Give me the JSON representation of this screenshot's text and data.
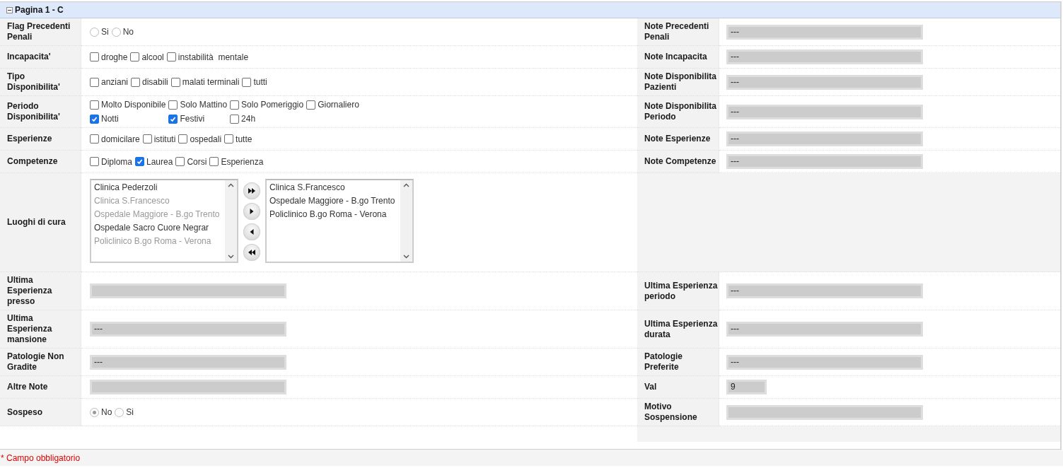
{
  "panel": {
    "title": "Pagina 1 - C",
    "expanded": true
  },
  "rows": [
    {
      "left": {
        "label": "Flag Precedenti Penali",
        "kind": "radio",
        "options": [
          {
            "label": "Si",
            "selected": false
          },
          {
            "label": "No",
            "selected": false
          }
        ]
      },
      "right": {
        "label": "Note Precedenti Penali",
        "kind": "field",
        "value": "---"
      }
    },
    {
      "left": {
        "label": "Incapacita'",
        "kind": "checks",
        "options": [
          {
            "label": "droghe",
            "checked": false
          },
          {
            "label": "alcool",
            "checked": false
          },
          {
            "label": "instabilità  mentale",
            "checked": false
          }
        ]
      },
      "right": {
        "label": "Note Incapacita",
        "kind": "field",
        "value": "---"
      }
    },
    {
      "left": {
        "label": "Tipo Disponibilita'",
        "kind": "checks",
        "options": [
          {
            "label": "anziani",
            "checked": false
          },
          {
            "label": "disabili",
            "checked": false
          },
          {
            "label": "malati terminali",
            "checked": false
          },
          {
            "label": "tutti",
            "checked": false
          }
        ]
      },
      "right": {
        "label": "Note Disponibilita Pazienti",
        "kind": "field",
        "value": "---"
      }
    },
    {
      "left": {
        "label": "Periodo Disponibilita'",
        "kind": "check-grid",
        "options": [
          {
            "label": "Molto Disponibile",
            "checked": false
          },
          {
            "label": "Solo Mattino",
            "checked": false
          },
          {
            "label": "Solo Pomeriggio",
            "checked": false
          },
          {
            "label": "Giornaliero",
            "checked": false
          },
          {
            "label": "Notti",
            "checked": true
          },
          {
            "label": "Festivi",
            "checked": true
          },
          {
            "label": "24h",
            "checked": false
          }
        ]
      },
      "right": {
        "label": "Note Disponibilita Periodo",
        "kind": "field",
        "value": "---"
      }
    },
    {
      "left": {
        "label": "Esperienze",
        "kind": "checks",
        "options": [
          {
            "label": "domicilare",
            "checked": false
          },
          {
            "label": "istituti",
            "checked": false
          },
          {
            "label": "ospedali",
            "checked": false
          },
          {
            "label": "tutte",
            "checked": false
          }
        ]
      },
      "right": {
        "label": "Note Esperienze",
        "kind": "field",
        "value": "---"
      }
    },
    {
      "left": {
        "label": "Competenze",
        "kind": "checks",
        "options": [
          {
            "label": "Diploma",
            "checked": false
          },
          {
            "label": "Laurea",
            "checked": true
          },
          {
            "label": "Corsi",
            "checked": false
          },
          {
            "label": "Esperienza",
            "checked": false
          }
        ]
      },
      "right": {
        "label": "Note Competenze",
        "kind": "field",
        "value": "---"
      }
    },
    {
      "left": {
        "label": "Luoghi di cura",
        "kind": "transfer",
        "available": [
          {
            "label": "Clinica Pederzoli",
            "disabled": false
          },
          {
            "label": "Clinica S.Francesco",
            "disabled": true
          },
          {
            "label": "Ospedale Maggiore - B.go Trento",
            "disabled": true
          },
          {
            "label": "Ospedale Sacro Cuore Negrar",
            "disabled": false
          },
          {
            "label": "Policlinico B.go Roma - Verona",
            "disabled": true
          }
        ],
        "chosen": [
          {
            "label": "Clinica S.Francesco"
          },
          {
            "label": "Ospedale Maggiore - B.go Trento"
          },
          {
            "label": "Policlinico B.go Roma - Verona"
          }
        ]
      }
    },
    {
      "left": {
        "label": "Ultima Esperienza presso",
        "kind": "field"
      },
      "right": {
        "label": "Ultima Esperienza periodo",
        "kind": "field",
        "value": "---"
      }
    },
    {
      "left": {
        "label": "Ultima Esperienza mansione",
        "kind": "field",
        "value": "---"
      },
      "right": {
        "label": "Ultima Esperienza durata",
        "kind": "field",
        "value": "---"
      }
    },
    {
      "left": {
        "label": "Patologie Non Gradite",
        "kind": "field",
        "value": "---"
      },
      "right": {
        "label": "Patologie Preferite",
        "kind": "field",
        "value": "---"
      }
    },
    {
      "left": {
        "label": "Altre Note",
        "kind": "field"
      },
      "right": {
        "label": "Val",
        "kind": "short-field",
        "value": "9"
      }
    },
    {
      "left": {
        "label": "Sospeso",
        "kind": "radio",
        "options": [
          {
            "label": "No",
            "selected": true
          },
          {
            "label": "Si",
            "selected": false
          }
        ]
      },
      "right": {
        "label": "Motivo Sospensione",
        "kind": "field"
      }
    }
  ],
  "footer": {
    "required_note": "* Campo obbligatorio"
  }
}
